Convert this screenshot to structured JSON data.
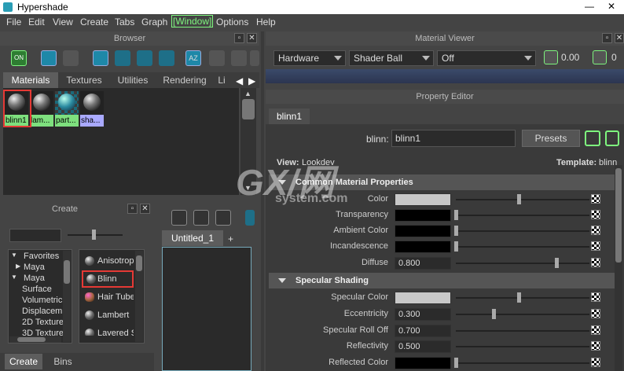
{
  "window": {
    "title": "Hypershade",
    "minimize": "—",
    "close": "✕"
  },
  "menu": [
    "File",
    "Edit",
    "View",
    "Create",
    "Tabs",
    "Graph",
    "[Window]",
    "Options",
    "Help"
  ],
  "browser": {
    "title": "Browser",
    "tabs": [
      "Materials",
      "Textures",
      "Utilities",
      "Rendering",
      "Li"
    ],
    "active_tab": "Materials",
    "swatches": [
      {
        "label": "blinn1",
        "color": "#7ee07e",
        "selected": true
      },
      {
        "label": "lam...",
        "color": "#7ee07e"
      },
      {
        "label": "part...",
        "color": "#7ee07e"
      },
      {
        "label": "sha...",
        "color": "#a9a9ff"
      }
    ]
  },
  "material_viewer": {
    "title": "Material Viewer",
    "renderer": "Hardware",
    "shape": "Shader Ball",
    "mode": "Off",
    "exposure": "0.00"
  },
  "property_editor": {
    "title": "Property Editor",
    "tab": "blinn1",
    "node_label": "blinn:",
    "node_name": "blinn1",
    "presets_label": "Presets",
    "view_label": "View:",
    "view_value": "Lookdev",
    "template_label": "Template:",
    "template_value": "blinn",
    "sections": [
      {
        "name": "Common Material Properties",
        "rows": [
          {
            "label": "Color",
            "value": "",
            "swatch": "#c8c8c8",
            "slider": 0.52
          },
          {
            "label": "Transparency",
            "value": "",
            "swatch": "#000000",
            "slider": 0.0
          },
          {
            "label": "Ambient Color",
            "value": "",
            "swatch": "#000000",
            "slider": 0.0
          },
          {
            "label": "Incandescence",
            "value": "",
            "swatch": "#000000",
            "slider": 0.0
          },
          {
            "label": "Diffuse",
            "value": "0.800",
            "swatch": "",
            "slider": 0.8
          }
        ]
      },
      {
        "name": "Specular Shading",
        "rows": [
          {
            "label": "Specular Color",
            "value": "",
            "swatch": "#c8c8c8",
            "slider": 0.5
          },
          {
            "label": "Eccentricity",
            "value": "0.300",
            "swatch": "",
            "slider": 0.3
          },
          {
            "label": "Specular Roll Off",
            "value": "0.700",
            "swatch": "",
            "slider": 0.7
          },
          {
            "label": "Reflectivity",
            "value": "0.500",
            "swatch": "",
            "slider": 0.5
          },
          {
            "label": "Reflected Color",
            "value": "",
            "swatch": "#000000",
            "slider": 0.0
          }
        ]
      }
    ]
  },
  "create": {
    "title": "Create",
    "categories": [
      "Favorites",
      "Maya",
      "Maya",
      "Surface",
      "Volumetric",
      "Displacem",
      "2D Texture",
      "3D Texture"
    ],
    "nodes": [
      "Anisotrop",
      "Blinn",
      "Hair Tube",
      "Lambert",
      "Layered S"
    ],
    "selected_node": "Blinn",
    "bottom_tabs": [
      "Create",
      "Bins"
    ]
  },
  "graph": {
    "tab": "Untitled_1",
    "add": "+"
  },
  "watermark": {
    "line1": "GX/网",
    "line2": "system.com"
  }
}
